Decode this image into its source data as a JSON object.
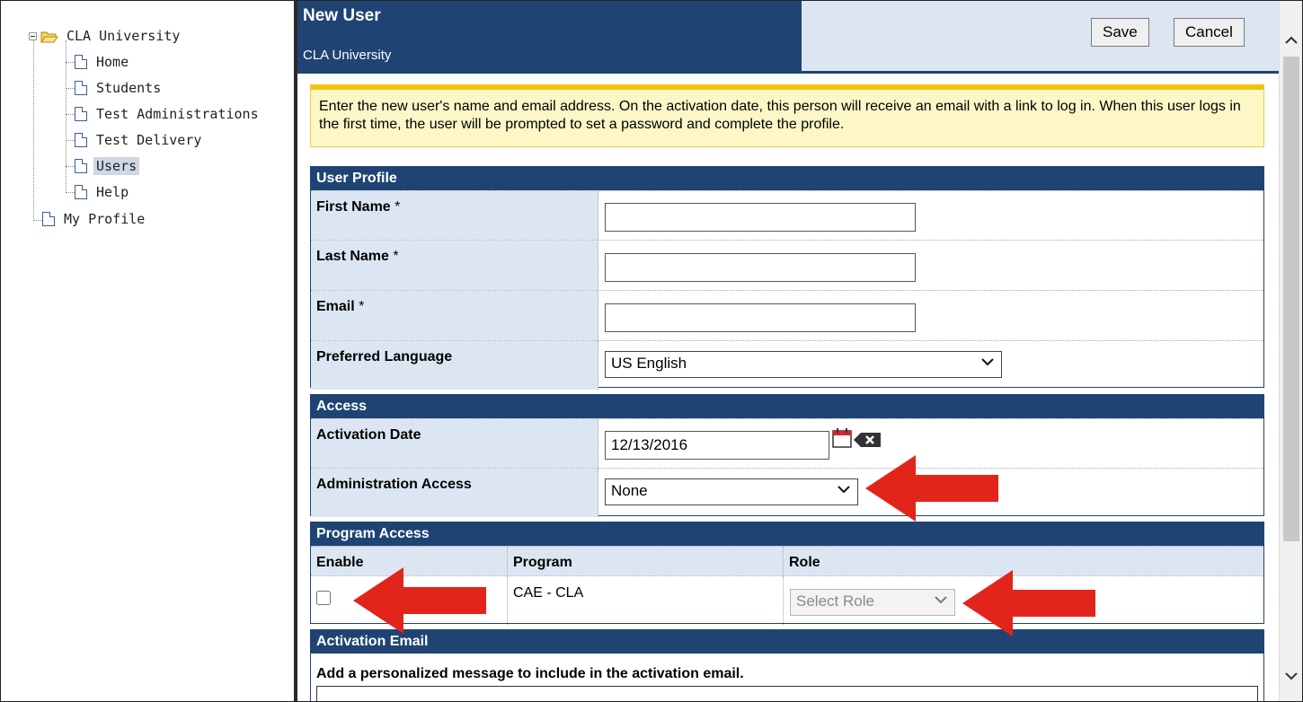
{
  "tree": {
    "root": "CLA University",
    "items": [
      "Home",
      "Students",
      "Test Administrations",
      "Test Delivery",
      "Users",
      "Help"
    ],
    "selected": "Users",
    "sibling": "My Profile"
  },
  "header": {
    "title": "New User",
    "subtitle": "CLA University",
    "save": "Save",
    "cancel": "Cancel"
  },
  "notice": "Enter the new user's name and email address. On the activation date, this person will receive an email with a link to log in. When this user logs in the first time, the user will be prompted to set a password and complete the profile.",
  "user_profile": {
    "heading": "User Profile",
    "first_name": "First Name",
    "last_name": "Last Name",
    "email": "Email",
    "required_mark": "*",
    "language_label": "Preferred Language",
    "language_value": "US English"
  },
  "access": {
    "heading": "Access",
    "activation_label": "Activation Date",
    "activation_value": "12/13/2016",
    "admin_label": "Administration Access",
    "admin_value": "None"
  },
  "program_access": {
    "heading": "Program Access",
    "columns": [
      "Enable",
      "Program",
      "Role"
    ],
    "rows": [
      {
        "enabled": false,
        "program": "CAE - CLA",
        "role": "Select Role"
      }
    ]
  },
  "activation_email": {
    "heading": "Activation Email",
    "prompt": "Add a personalized message to include in the activation email."
  },
  "colors": {
    "header": "#1f4473",
    "header_light": "#dce6f2",
    "notice_bg": "#fdf7c8",
    "arrow": "#e3241b"
  }
}
